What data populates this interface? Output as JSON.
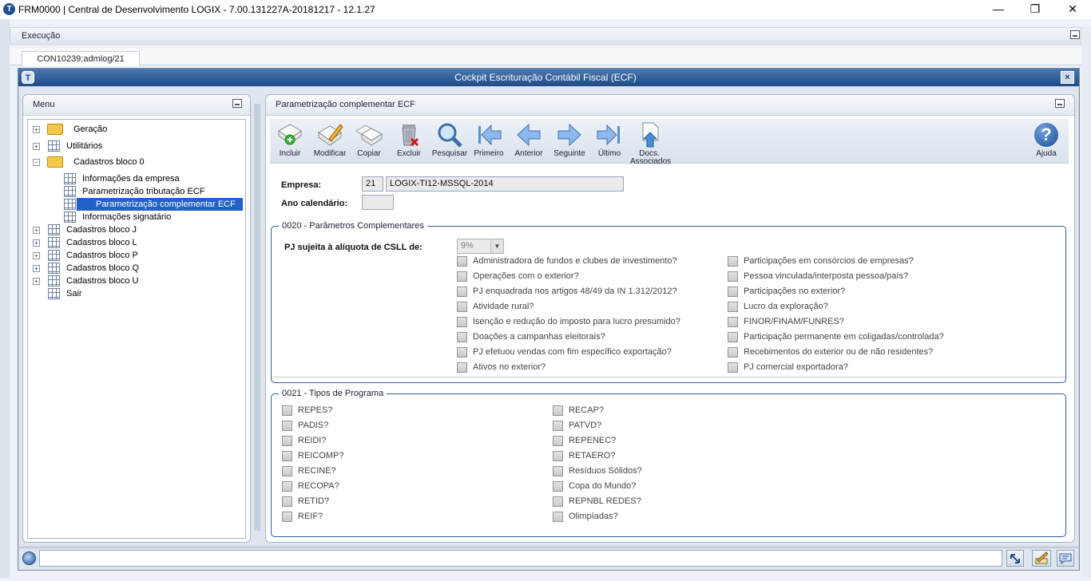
{
  "window": {
    "title": "FRM0000 | Central de Desenvolvimento LOGIX  -  7.00.131227A-20181217  -  12.1.27",
    "min": "—",
    "max": "❐",
    "close": "✕"
  },
  "exec_bar": {
    "label": "Execução"
  },
  "tab": {
    "label": "CON10239:admlog/21"
  },
  "frame": {
    "title": "Cockpit Escrituração Contábil Fiscal (ECF)",
    "close": "×",
    "icon_letter": "T"
  },
  "menu": {
    "title": "Menu",
    "items": [
      {
        "label": "Geração",
        "icon": "folder-icon",
        "expander": "+",
        "level": 0
      },
      {
        "label": "Utilitários",
        "icon": "grid-icon",
        "expander": "+",
        "level": 0
      },
      {
        "label": "Cadastros bloco 0",
        "icon": "folder-open-icon",
        "expander": "−",
        "level": 0
      },
      {
        "label": "Informações da empresa",
        "icon": "grid-icon",
        "expander": "",
        "level": 1
      },
      {
        "label": "Parametrização tributação ECF",
        "icon": "grid-icon",
        "expander": "",
        "level": 1
      },
      {
        "label": "Parametrização complementar ECF",
        "icon": "grid-icon",
        "expander": "",
        "level": 1,
        "selected": true
      },
      {
        "label": "Informações signatário",
        "icon": "grid-icon",
        "expander": "",
        "level": 1
      },
      {
        "label": "Cadastros bloco J",
        "icon": "grid-icon",
        "expander": "+",
        "level": 0
      },
      {
        "label": "Cadastros bloco L",
        "icon": "grid-icon",
        "expander": "+",
        "level": 0
      },
      {
        "label": "Cadastros bloco P",
        "icon": "grid-icon",
        "expander": "+",
        "level": 0
      },
      {
        "label": "Cadastros bloco Q",
        "icon": "grid-icon",
        "expander": "+",
        "level": 0
      },
      {
        "label": "Cadastros bloco U",
        "icon": "grid-icon",
        "expander": "+",
        "level": 0
      },
      {
        "label": "Sair",
        "icon": "grid-icon",
        "expander": "",
        "level": 0
      }
    ]
  },
  "main": {
    "title": "Parametrização complementar ECF"
  },
  "toolbar": {
    "incluir": "Incluir",
    "modificar": "Modificar",
    "copiar": "Copiar",
    "excluir": "Excluir",
    "pesquisar": "Pesquisar",
    "primeiro": "Primeiro",
    "anterior": "Anterior",
    "seguinte": "Seguinte",
    "ultimo": "Último",
    "docs_line1": "Docs.",
    "docs_line2": "Associados",
    "ajuda": "Ajuda",
    "help_glyph": "?"
  },
  "form": {
    "empresa_label": "Empresa:",
    "empresa_code": "21",
    "empresa_name": "LOGIX-TI12-MSSQL-2014",
    "ano_label": "Ano calendário:",
    "ano_value": ""
  },
  "group0020": {
    "title": "0020 - Parâmetros Complementares",
    "csll_label": "PJ sujeita à alíquota de CSLL de:",
    "csll_value": "9%",
    "left": [
      "Administradora de fundos e clubes de investimento?",
      "Operações com o exterior?",
      "PJ enquadrada nos artigos 48/49 da IN 1.312/2012?",
      "Atividade rural?",
      "Isenção e redução do imposto para lucro presumido?",
      "Doações a campanhas eleitorais?",
      "PJ efetuou vendas com fim específico exportação?",
      "Ativos no exterior?"
    ],
    "right": [
      "Participações em consórcios de empresas?",
      "Pessoa vinculada/interposta pessoa/país?",
      "Participações no exterior?",
      "Lucro da exploração?",
      "FINOR/FINAM/FUNRES?",
      "Participação permanente em coligadas/controlada?",
      "Recebimentos do exterior ou de não residentes?",
      "PJ comercial exportadora?"
    ]
  },
  "group0021": {
    "title": "0021 - Tipos de Programa",
    "left": [
      "REPES?",
      "PADIS?",
      "REIDI?",
      "REICOMP?",
      "RECINE?",
      "RECOPA?",
      "RETID?",
      "REIF?"
    ],
    "right": [
      "RECAP?",
      "PATVD?",
      "REPENEC?",
      "RETAERO?",
      "Resíduos Sólidos?",
      "Copa do Mundo?",
      "REPNBL REDES?",
      "Olimpíadas?"
    ]
  },
  "status": {
    "text": ""
  }
}
